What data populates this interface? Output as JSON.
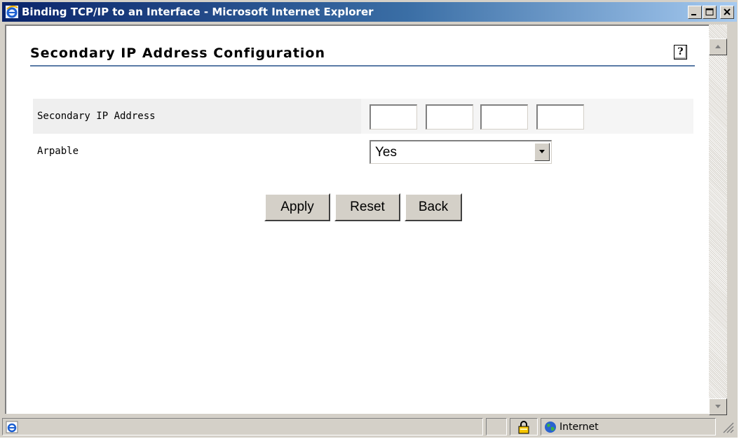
{
  "window": {
    "title": "Binding TCP/IP to an Interface - Microsoft Internet Explorer"
  },
  "page": {
    "title": "Secondary IP Address Configuration",
    "help_icon_glyph": "?"
  },
  "form": {
    "secondary_ip_label": "Secondary IP Address",
    "ip_octets": [
      "",
      "",
      "",
      ""
    ],
    "arpable_label": "Arpable",
    "arpable_value": "Yes"
  },
  "buttons": {
    "apply": "Apply",
    "reset": "Reset",
    "back": "Back"
  },
  "statusbar": {
    "zone": "Internet"
  },
  "colors": {
    "title_gradient_start": "#0a246a",
    "title_gradient_end": "#a6caf0",
    "title_underline": "#5a7ba6",
    "row_shade": "#efefef",
    "chrome": "#d4d0c8"
  }
}
